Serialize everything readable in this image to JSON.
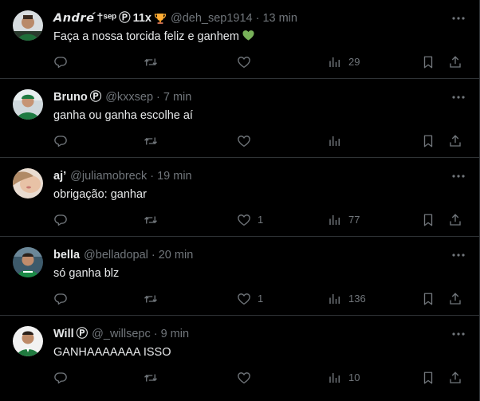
{
  "colors": {
    "background": "#000000",
    "text": "#e7e9ea",
    "muted": "#71767b",
    "divider": "#2f3336",
    "emoji_heart": "#78b159",
    "trophy": "#ffac33"
  },
  "icons": {
    "reply": "reply-icon",
    "repost": "repost-icon",
    "like": "heart-icon",
    "views": "views-icon",
    "bookmark": "bookmark-icon",
    "share": "share-icon",
    "more": "more-icon"
  },
  "tweets": [
    {
      "name": "𝘼𝙣𝙙𝙧𝙚́",
      "name_suffix": "†ˢᵉᵖ",
      "badge": "Ⓟ",
      "name_extra": "11x",
      "handle": "@deh_sep1914",
      "time": "13 min",
      "text": "Faça a nossa torcida feliz e ganhem",
      "emoji": "green-heart",
      "replies": "",
      "reposts": "",
      "likes": "",
      "views": "29"
    },
    {
      "name": "Bruno",
      "badge": "Ⓟ",
      "handle": "@kxxsep",
      "time": "7 min",
      "text": "ganha ou ganha escolhe aí",
      "replies": "",
      "reposts": "",
      "likes": "",
      "views": ""
    },
    {
      "name": "aj’",
      "handle": "@juliamobreck",
      "time": "19 min",
      "text": "obrigação: ganhar",
      "replies": "",
      "reposts": "",
      "likes": "1",
      "views": "77"
    },
    {
      "name": "bella",
      "handle": "@belladopal",
      "time": "20 min",
      "text": "só ganha blz",
      "replies": "",
      "reposts": "",
      "likes": "1",
      "views": "136"
    },
    {
      "name": "Will",
      "badge": "Ⓟ",
      "handle": "@_willsepc",
      "time": "9 min",
      "text": "GANHAAAAAAA ISSO",
      "replies": "",
      "reposts": "",
      "likes": "",
      "views": "10"
    }
  ]
}
